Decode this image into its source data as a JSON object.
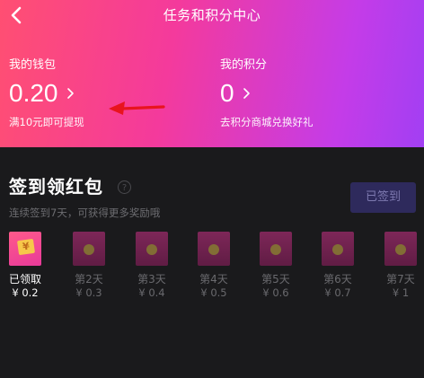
{
  "header": {
    "title": "任务和积分中心",
    "wallet": {
      "label": "我的钱包",
      "value": "0.20",
      "note": "满10元即可提现"
    },
    "points": {
      "label": "我的积分",
      "value": "0",
      "note": "去积分商城兑换好礼"
    }
  },
  "signin": {
    "title": "签到领红包",
    "help_icon": "?",
    "subtitle": "连续签到7天，可获得更多奖励哦",
    "button_label": "已签到",
    "days": [
      {
        "label": "已领取",
        "amount": "¥ 0.2",
        "claimed": true,
        "coupon_glyph": "¥"
      },
      {
        "label": "第2天",
        "amount": "¥ 0.3",
        "claimed": false
      },
      {
        "label": "第3天",
        "amount": "¥ 0.4",
        "claimed": false
      },
      {
        "label": "第4天",
        "amount": "¥ 0.5",
        "claimed": false
      },
      {
        "label": "第5天",
        "amount": "¥ 0.6",
        "claimed": false
      },
      {
        "label": "第6天",
        "amount": "¥ 0.7",
        "claimed": false
      },
      {
        "label": "第7天",
        "amount": "¥ 1",
        "claimed": false
      }
    ]
  },
  "colors": {
    "header_gradient_start": "#ff4f72",
    "header_gradient_end": "#a23ff3",
    "annotation_arrow": "#e8141e",
    "background": "#1a1a1c"
  },
  "icons": {
    "back": "back-arrow-icon",
    "chevron": "chevron-right-icon",
    "help": "question-circle-icon",
    "coin": "coin-icon",
    "coupon": "coupon-icon",
    "annotation": "red-arrow-annotation"
  }
}
